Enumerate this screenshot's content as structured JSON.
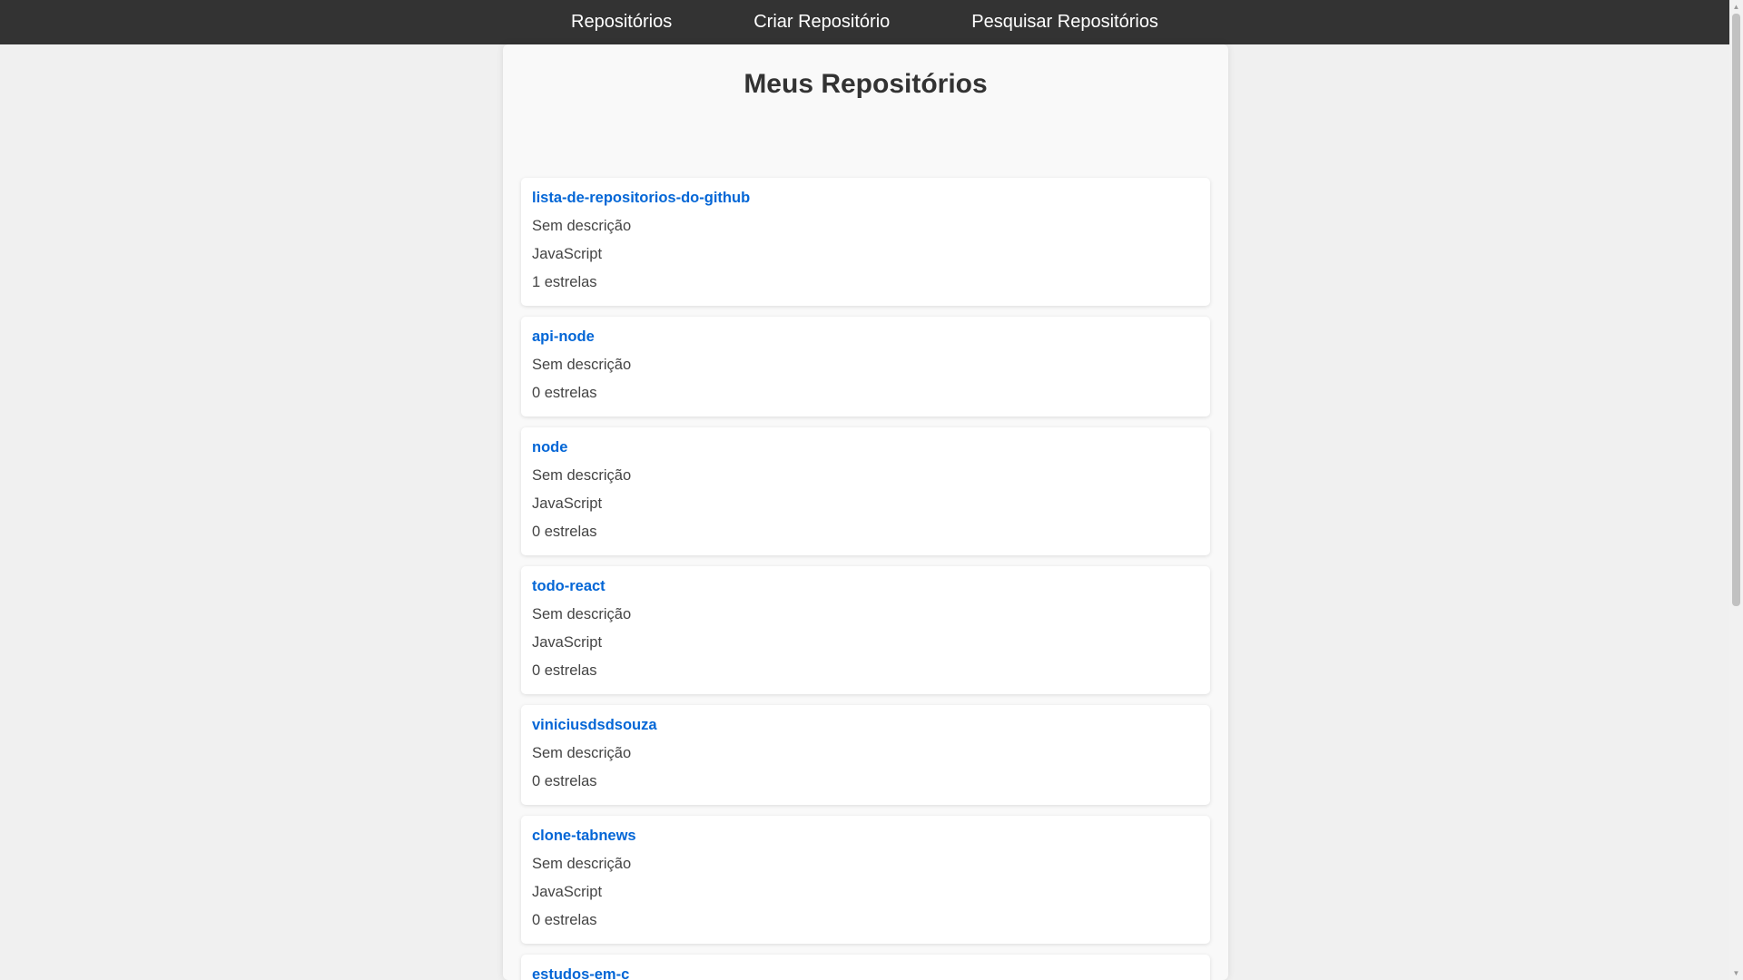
{
  "nav": {
    "items": [
      "Repositórios",
      "Criar Repositório",
      "Pesquisar Repositórios"
    ]
  },
  "page": {
    "title": "Meus Repositórios"
  },
  "repos": [
    {
      "name": "lista-de-repositorios-do-github",
      "description": "Sem descrição",
      "language": "JavaScript",
      "stars": "1 estrelas"
    },
    {
      "name": "api-node",
      "description": "Sem descrição",
      "language": null,
      "stars": "0 estrelas"
    },
    {
      "name": "node",
      "description": "Sem descrição",
      "language": "JavaScript",
      "stars": "0 estrelas"
    },
    {
      "name": "todo-react",
      "description": "Sem descrição",
      "language": "JavaScript",
      "stars": "0 estrelas"
    },
    {
      "name": "viniciusdsdsouza",
      "description": "Sem descrição",
      "language": null,
      "stars": "0 estrelas"
    },
    {
      "name": "clone-tabnews",
      "description": "Sem descrição",
      "language": "JavaScript",
      "stars": "0 estrelas"
    },
    {
      "name": "estudos-em-c",
      "description": "",
      "language": null,
      "stars": ""
    }
  ],
  "colors": {
    "navbar": "#333333",
    "link": "#0366d6",
    "background": "#f0f0f0"
  }
}
